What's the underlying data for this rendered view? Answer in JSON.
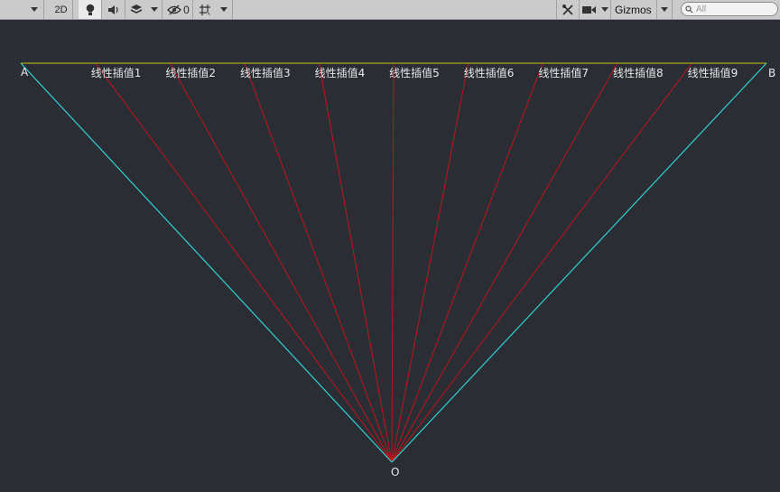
{
  "toolbar": {
    "mode_2d_label": "2D",
    "hidden_count": "0",
    "gizmos_label": "Gizmos",
    "search_placeholder": "All",
    "icons": [
      "dropdown-arrow-icon",
      "lighting-icon",
      "audio-icon",
      "effects-layers-icon",
      "dropdown-arrow-icon",
      "visibility-hidden-icon",
      "grid-snap-icon",
      "dropdown-arrow-icon",
      "tools-icon",
      "camera-icon",
      "dropdown-arrow-icon",
      "search-icon"
    ]
  },
  "scene": {
    "point_a_label": "A",
    "point_b_label": "B",
    "point_o_label": "O",
    "interp_labels": [
      "线性插值1",
      "线性插值2",
      "线性插值3",
      "线性插值4",
      "线性插值5",
      "线性插值6",
      "线性插值7",
      "线性插值8",
      "线性插值9"
    ],
    "colors": {
      "background": "#2a2d33",
      "segment_ab": "#c9c21c",
      "edges_oa_ob": "#2fd3d3",
      "interp_lines": "#c0151b",
      "label_text": "#e8e8e8"
    }
  }
}
